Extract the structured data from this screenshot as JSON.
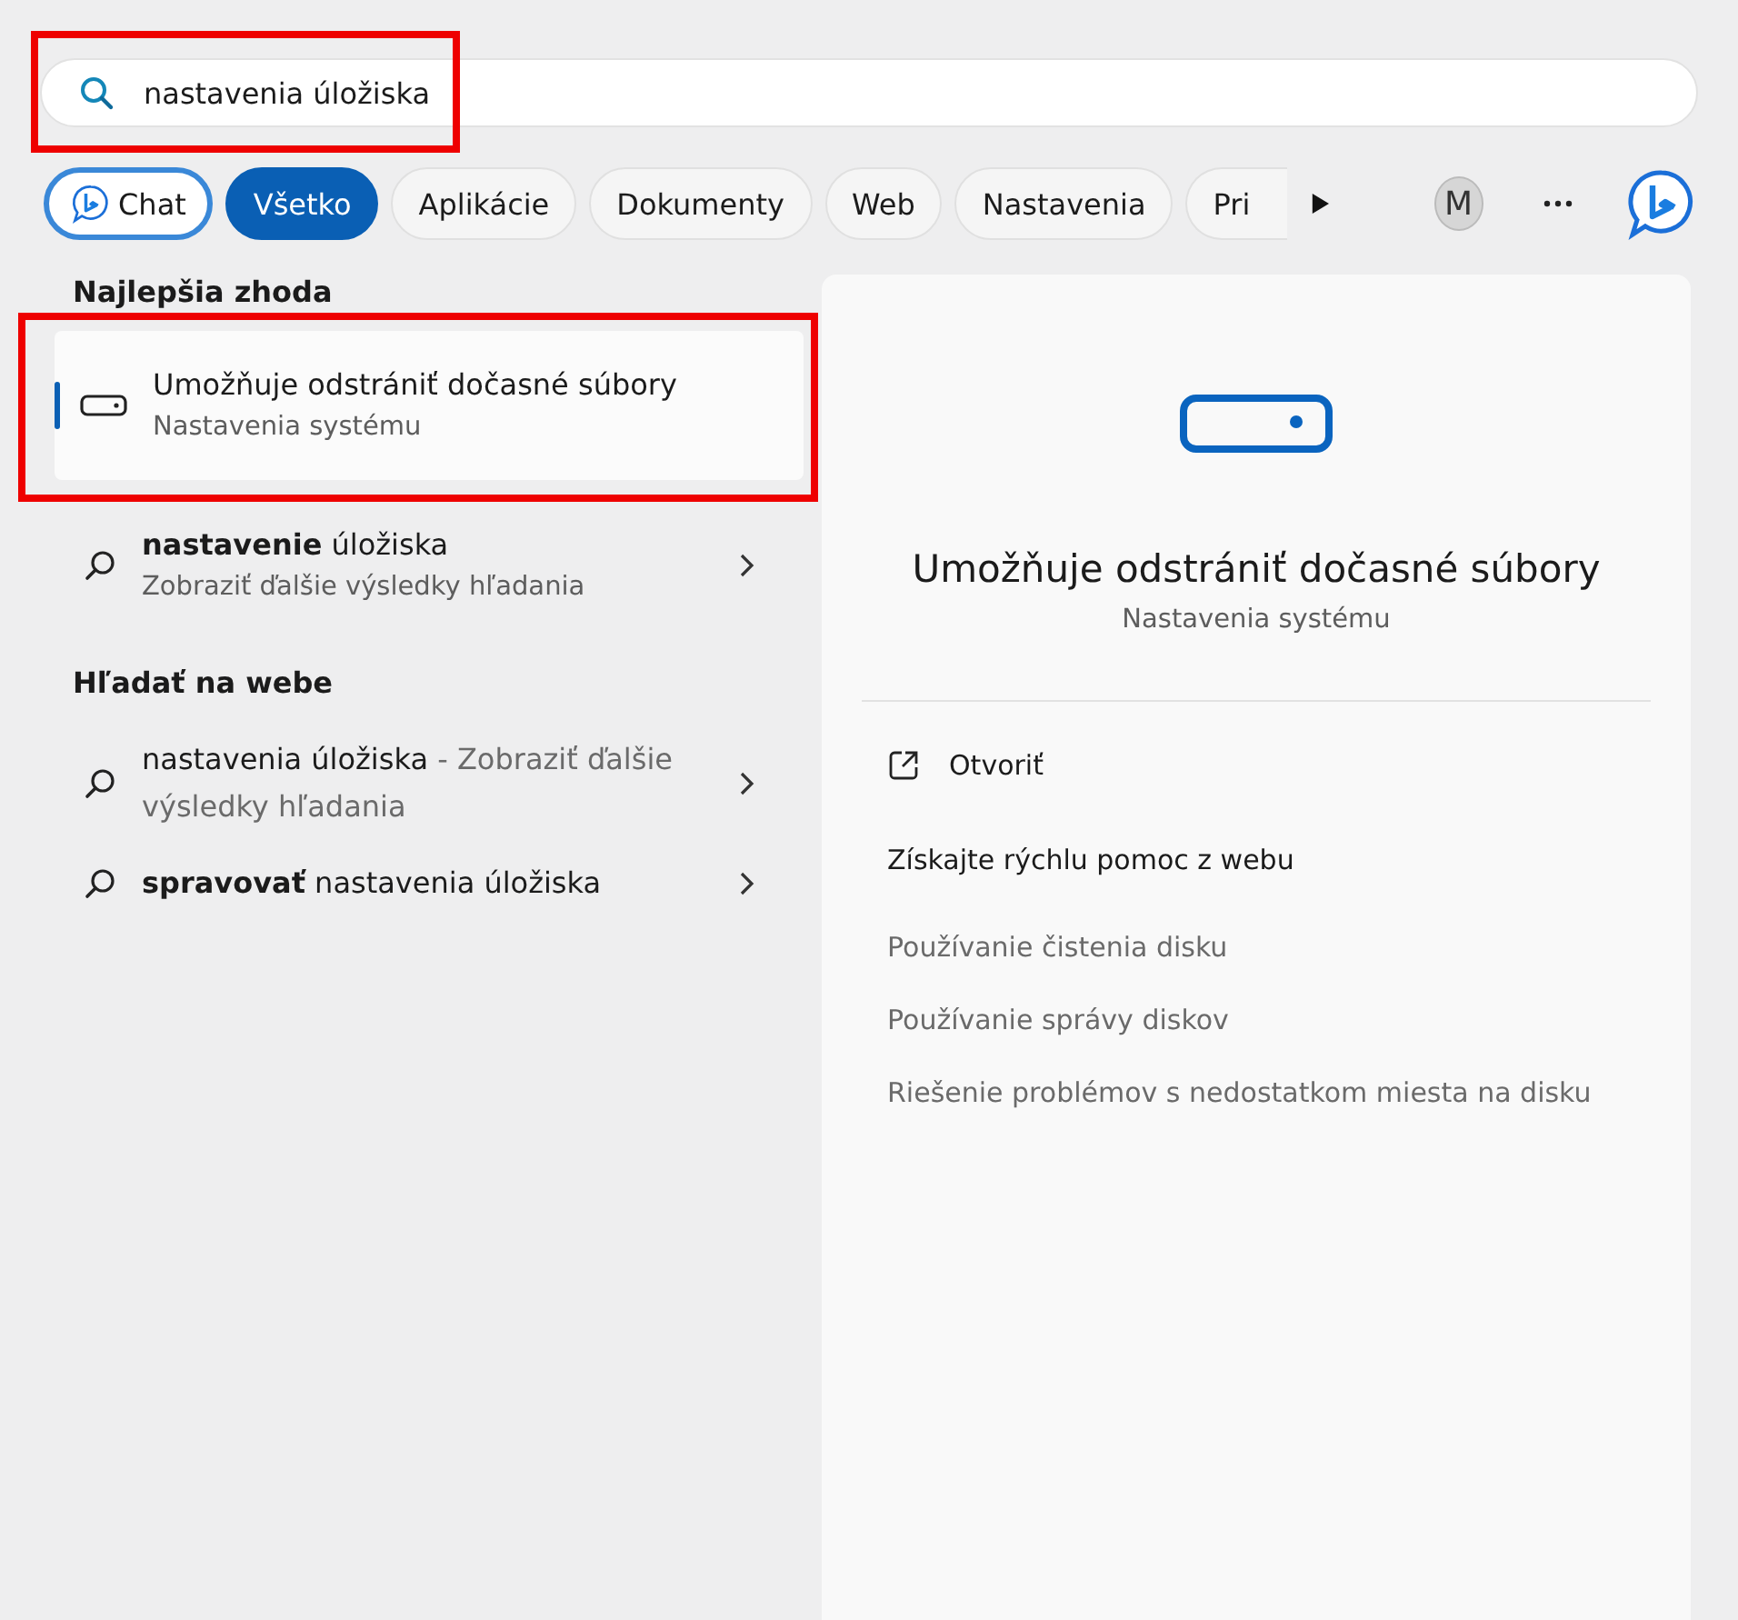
{
  "search": {
    "value": "nastavenia úložiska",
    "annotated": true
  },
  "filters": [
    {
      "label": "Chat",
      "kind": "chat",
      "selected": false
    },
    {
      "label": "Všetko",
      "kind": "tab",
      "selected": true
    },
    {
      "label": "Aplikácie",
      "kind": "tab",
      "selected": false
    },
    {
      "label": "Dokumenty",
      "kind": "tab",
      "selected": false
    },
    {
      "label": "Web",
      "kind": "tab",
      "selected": false
    },
    {
      "label": "Nastavenia",
      "kind": "tab",
      "selected": false
    },
    {
      "label": "Pri",
      "kind": "tab",
      "selected": false
    }
  ],
  "account": {
    "initial": "M"
  },
  "best_match": {
    "heading": "Najlepšia zhoda",
    "title": "Umožňuje odstrániť dočasné súbory",
    "subtitle": "Nastavenia systému",
    "selected": true,
    "annotated": true
  },
  "search_suggestion": {
    "title": "**nastavenie** úložiska",
    "subtitle": "Zobraziť ďalšie výsledky hľadania"
  },
  "web": {
    "heading": "Hľadať na webe",
    "results": [
      {
        "query": "nastavenia úložiska",
        "hint": "- Zobraziť ďalšie výsledky hľadania"
      },
      {
        "query": "**spravovať** nastavenia úložiska"
      }
    ]
  },
  "detail": {
    "title": "Umožňuje odstrániť dočasné súbory",
    "subtitle": "Nastavenia systému",
    "open_label": "Otvoriť",
    "help_heading": "Získajte rýchlu pomoc z webu",
    "help_links": [
      "Používanie čistenia disku",
      "Používanie správy diskov",
      "Riešenie problémov s nedostatkom miesta na disku"
    ]
  }
}
